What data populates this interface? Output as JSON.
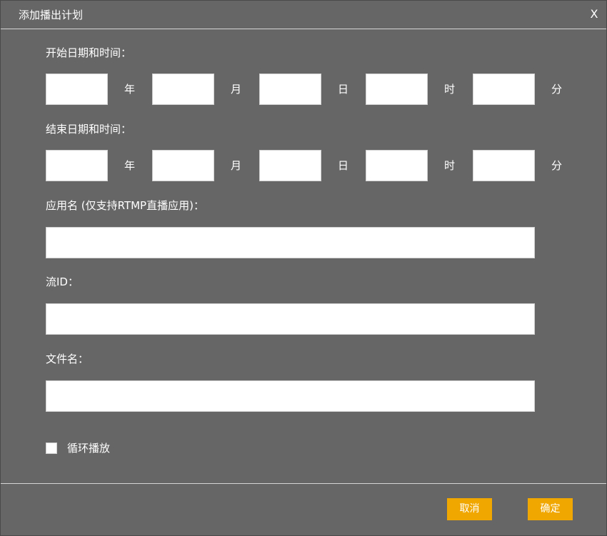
{
  "dialog": {
    "title": "添加播出计划",
    "close_label": "X"
  },
  "start": {
    "label": "开始日期和时间：",
    "fields": [
      {
        "unit": "年",
        "value": ""
      },
      {
        "unit": "月",
        "value": ""
      },
      {
        "unit": "日",
        "value": ""
      },
      {
        "unit": "时",
        "value": ""
      },
      {
        "unit": "分",
        "value": ""
      }
    ]
  },
  "end": {
    "label": "结束日期和时间：",
    "fields": [
      {
        "unit": "年",
        "value": ""
      },
      {
        "unit": "月",
        "value": ""
      },
      {
        "unit": "日",
        "value": ""
      },
      {
        "unit": "时",
        "value": ""
      },
      {
        "unit": "分",
        "value": ""
      }
    ]
  },
  "app_name": {
    "label": "应用名 (仅支持RTMP直播应用)：",
    "value": ""
  },
  "stream_id": {
    "label": "流ID：",
    "value": ""
  },
  "file_name": {
    "label": "文件名：",
    "value": ""
  },
  "loop": {
    "label": "循环播放",
    "checked": false
  },
  "buttons": {
    "cancel": "取消",
    "confirm": "确定"
  },
  "colors": {
    "background": "#666666",
    "button": "#f0a700",
    "divider": "#d6d6d6"
  }
}
